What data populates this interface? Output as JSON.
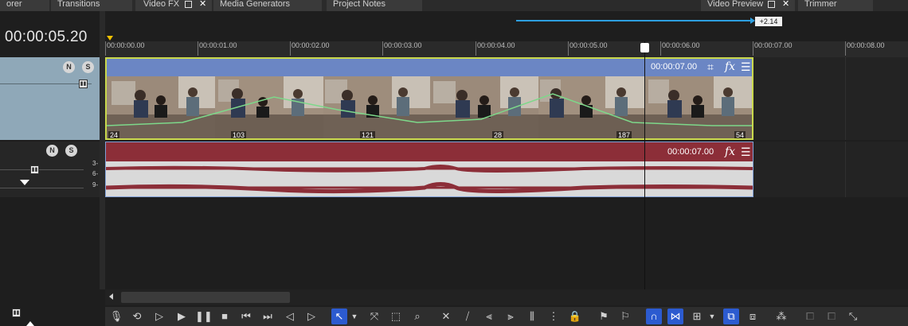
{
  "tabs": [
    {
      "label": "orer"
    },
    {
      "label": "Transitions"
    },
    {
      "label": "Video FX"
    },
    {
      "label": "Media Generators"
    },
    {
      "label": "Project Notes"
    },
    {
      "label": "Video Preview"
    },
    {
      "label": "Trimmer"
    }
  ],
  "timecode": "00:00:05.20",
  "rate_badge": "+2.14",
  "ruler_ticks": [
    "00:00:00.00",
    "00:00:01.00",
    "00:00:02.00",
    "00:00:03.00",
    "00:00:04.00",
    "00:00:05.00",
    "00:00:06.00",
    "00:00:07.00",
    "00:00:08.00"
  ],
  "video_event": {
    "duration": "00:00:07.00",
    "frame_numbers": [
      "24",
      "103",
      "121",
      "28",
      "187",
      "54"
    ]
  },
  "audio_event": {
    "duration": "00:00:07.00",
    "channel_labels": [
      "3-",
      "6-",
      "9-"
    ]
  },
  "track_buttons": {
    "mute": "N",
    "solo": "S"
  },
  "colors": {
    "video_header": "#8fa8b8",
    "video_event": "#6b86c4",
    "audio_event_head": "#8c2e38",
    "selection_border": "#c9d84c",
    "accent": "#2c5bd0"
  }
}
